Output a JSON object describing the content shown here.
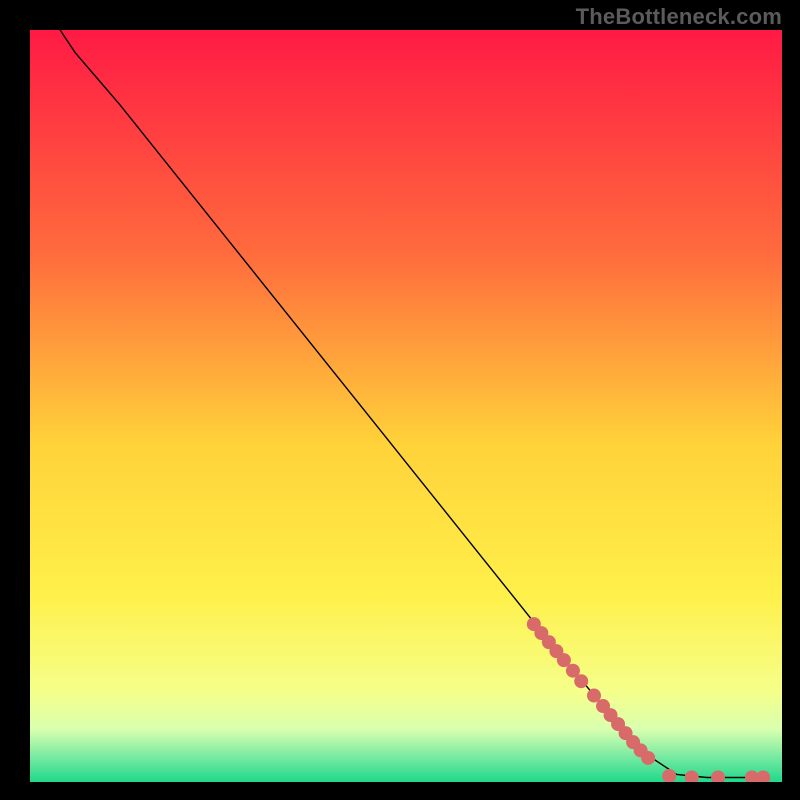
{
  "attribution": "TheBottleneck.com",
  "chart_data": {
    "type": "line",
    "title": "",
    "xlabel": "",
    "ylabel": "",
    "xlim": [
      0,
      100
    ],
    "ylim": [
      0,
      100
    ],
    "grid": false,
    "legend": false,
    "background_gradient": {
      "stops": [
        {
          "offset": 0.0,
          "color": "#ff1a44"
        },
        {
          "offset": 0.3,
          "color": "#ff6c3d"
        },
        {
          "offset": 0.55,
          "color": "#ffd23a"
        },
        {
          "offset": 0.75,
          "color": "#fff04a"
        },
        {
          "offset": 0.88,
          "color": "#f5ff8a"
        },
        {
          "offset": 0.93,
          "color": "#d9ffb0"
        },
        {
          "offset": 0.97,
          "color": "#6fe8a0"
        },
        {
          "offset": 1.0,
          "color": "#1fd98a"
        }
      ]
    },
    "series": [
      {
        "name": "curve",
        "stroke": "#000000",
        "stroke_width": 1.4,
        "points": [
          {
            "x": 4,
            "y": 100
          },
          {
            "x": 6,
            "y": 97
          },
          {
            "x": 9,
            "y": 93.5
          },
          {
            "x": 12,
            "y": 90
          },
          {
            "x": 16,
            "y": 85
          },
          {
            "x": 20,
            "y": 80
          },
          {
            "x": 30,
            "y": 67.5
          },
          {
            "x": 40,
            "y": 55
          },
          {
            "x": 50,
            "y": 42.5
          },
          {
            "x": 60,
            "y": 30
          },
          {
            "x": 70,
            "y": 17.5
          },
          {
            "x": 78,
            "y": 8
          },
          {
            "x": 83,
            "y": 3
          },
          {
            "x": 86,
            "y": 1
          },
          {
            "x": 90,
            "y": 0.6
          },
          {
            "x": 97,
            "y": 0.6
          }
        ]
      }
    ],
    "markers": {
      "color": "#d96a6a",
      "radius": 7,
      "points": [
        {
          "x": 67,
          "y": 21
        },
        {
          "x": 68,
          "y": 19.8
        },
        {
          "x": 69,
          "y": 18.6
        },
        {
          "x": 70,
          "y": 17.4
        },
        {
          "x": 71,
          "y": 16.2
        },
        {
          "x": 72.2,
          "y": 14.8
        },
        {
          "x": 73.3,
          "y": 13.4
        },
        {
          "x": 75,
          "y": 11.5
        },
        {
          "x": 76.2,
          "y": 10.1
        },
        {
          "x": 77.2,
          "y": 8.9
        },
        {
          "x": 78.2,
          "y": 7.7
        },
        {
          "x": 79.2,
          "y": 6.5
        },
        {
          "x": 80.2,
          "y": 5.3
        },
        {
          "x": 81.2,
          "y": 4.2
        },
        {
          "x": 82.2,
          "y": 3.2
        },
        {
          "x": 85,
          "y": 0.8
        },
        {
          "x": 88,
          "y": 0.6
        },
        {
          "x": 91.5,
          "y": 0.6
        },
        {
          "x": 96,
          "y": 0.6
        },
        {
          "x": 97.5,
          "y": 0.6
        }
      ]
    }
  }
}
